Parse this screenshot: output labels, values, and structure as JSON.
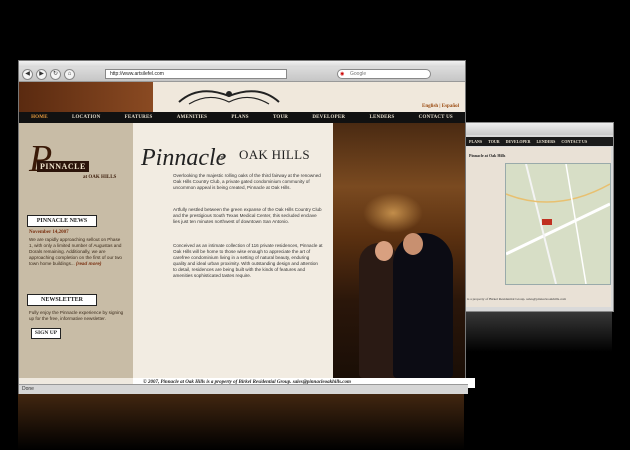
{
  "browser": {
    "url": "http://www.artsilefel.com",
    "search_placeholder": "Google",
    "status": "Done"
  },
  "site": {
    "language_links": "English | Español",
    "nav": [
      "HOME",
      "LOCATION",
      "FEATURES",
      "AMENITIES",
      "PLANS",
      "TOUR",
      "DEVELOPER",
      "LENDERS",
      "CONTACT US"
    ],
    "logo": {
      "initial": "P",
      "name": "PINNACLE",
      "sub": "at OAK HILLS"
    },
    "news": {
      "title": "PINNACLE NEWS",
      "date": "November 14,2007",
      "body": "We are rapidly approaching sellout on Phase 1, with only a limited number of Augustas and Dorals remaining. Additionally, we are approaching completion on the first of our two town home buildings...",
      "read_more": "(read more)"
    },
    "newsletter": {
      "title": "NEWSLETTER",
      "body": "Fully enjoy the Pinnacle experience by signing up for the free, informative newsletter.",
      "button": "SIGN UP"
    },
    "heading": {
      "script": "Pinnacle",
      "at": "at",
      "place": "OAK HILLS"
    },
    "paragraphs": [
      "Overlooking the majestic rolling oaks of the third fairway at the renowned Oak Hills Country Club, a private gated condominium community of uncommon appeal is being created, Pinnacle at Oak Hills.",
      "Artfully nestled between the green expanse of the Oak Hills Country Club and the prestigious South Texas Medical Center, this secluded enclave lies just ten minutes northwest of downtown San Antonio.",
      "Conceived as an intimate collection of 116 private residences, Pinnacle at Oak Hills will be home to those wise enough to appreciate the art of carefree condominium living in a setting of natural beauty, enduring quality and ideal urban proximity. With outstanding design and attention to detail, residences are being built with the kinds of features and amenities sophisticated tastes require."
    ],
    "footer": "© 2007, Pinnacle at Oak Hills is a property of Birkel Residential Group. sales@pinnacleoakhills.com"
  },
  "back_window": {
    "nav": [
      "PLANS",
      "TOUR",
      "DEVELOPER",
      "LENDERS",
      "CONTACT US"
    ],
    "title": "Pinnacle at Oak Hills",
    "footer": "is a property of Birkel Residential Group. sales@pinnacleoakhills.com"
  }
}
